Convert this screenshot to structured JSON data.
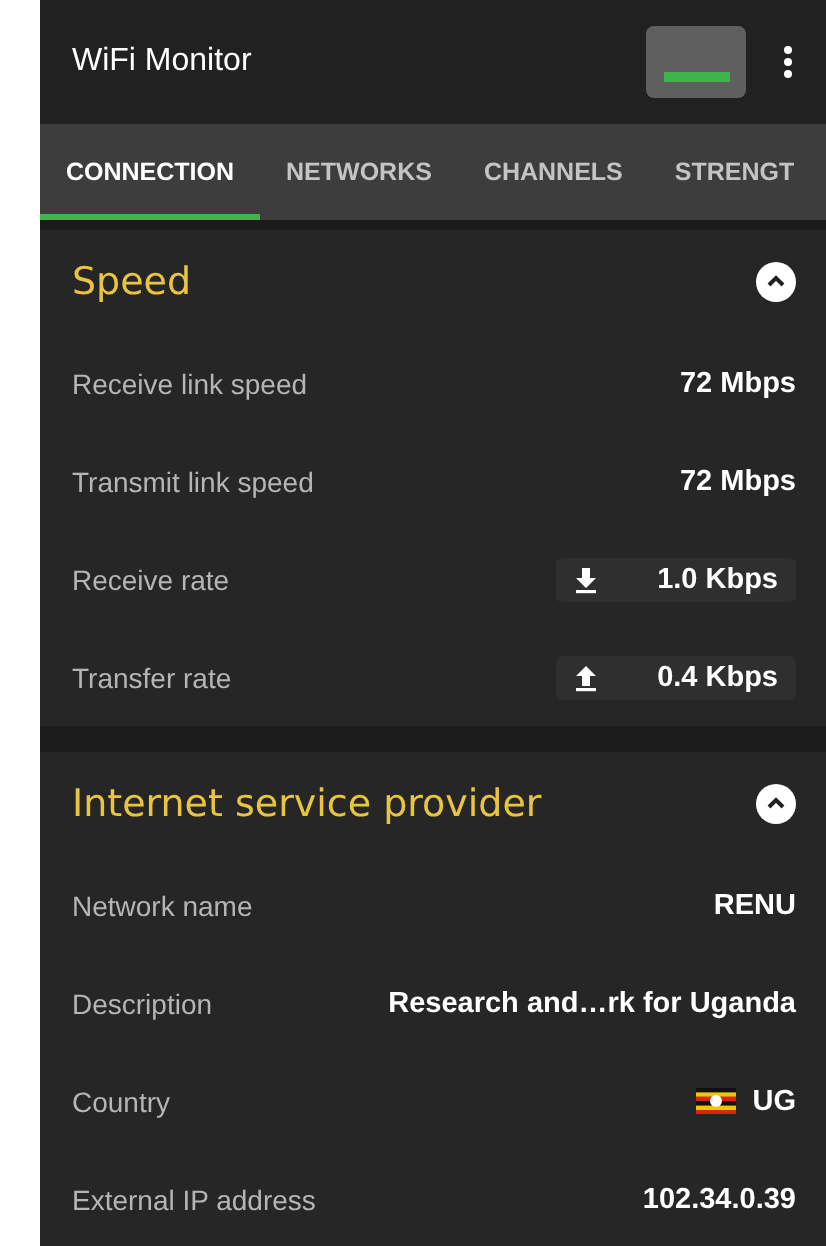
{
  "app_bar": {
    "title": "WiFi Monitor"
  },
  "tabs": [
    {
      "label": "CONNECTION",
      "selected": true
    },
    {
      "label": "NETWORKS",
      "selected": false
    },
    {
      "label": "CHANNELS",
      "selected": false
    },
    {
      "label": "STRENGT",
      "selected": false
    }
  ],
  "sections": [
    {
      "title": "Speed",
      "expanded": true,
      "rows": [
        {
          "kind": "plain",
          "label": "Receive link speed",
          "value": "72 Mbps"
        },
        {
          "kind": "plain",
          "label": "Transmit link speed",
          "value": "72 Mbps"
        },
        {
          "kind": "download",
          "label": "Receive rate",
          "value": "1.0 Kbps"
        },
        {
          "kind": "upload",
          "label": "Transfer rate",
          "value": "0.4 Kbps"
        }
      ]
    },
    {
      "title": "Internet service provider",
      "expanded": true,
      "rows": [
        {
          "kind": "plain",
          "label": "Network name",
          "value": "RENU"
        },
        {
          "kind": "plain",
          "label": "Description",
          "value": "Research and…rk for Uganda"
        },
        {
          "kind": "flag",
          "label": "Country",
          "value": "UG"
        },
        {
          "kind": "plain",
          "label": "External IP address",
          "value": "102.34.0.39"
        }
      ]
    }
  ]
}
